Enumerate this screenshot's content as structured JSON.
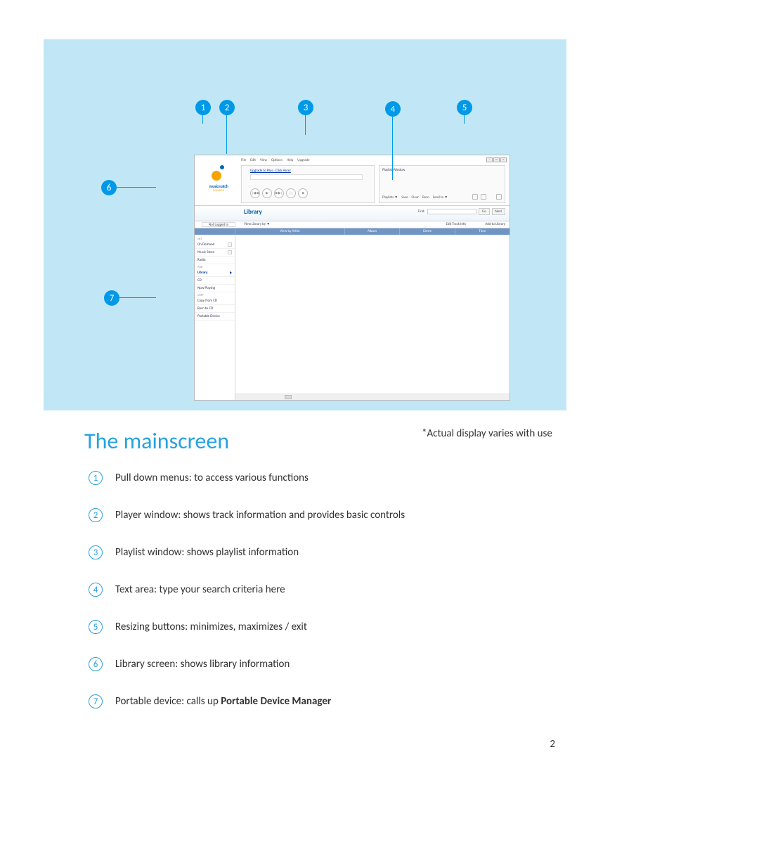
{
  "figure": {
    "caption": "*Actual display varies with use",
    "callouts": [
      "1",
      "2",
      "3",
      "4",
      "5",
      "6",
      "7"
    ]
  },
  "app": {
    "brand": {
      "name": "musicmatch",
      "sub": "JUKEBOX"
    },
    "menubar": [
      "File",
      "Edit",
      "View",
      "Options",
      "Help",
      "Upgrade"
    ],
    "upgrade_link": "Upgrade to Plus - Click Here!",
    "transport": {
      "prev": "|◀◀",
      "play": "▶",
      "next": "▶▶|",
      "pause": "||",
      "stop": "■"
    },
    "playlist": {
      "title": "Playlist Window",
      "tools": [
        "Playlists ▼",
        "Save",
        "Clear",
        "Burn",
        "Send to ▼"
      ]
    },
    "winbtns": [
      "–",
      "□",
      "×"
    ],
    "library": {
      "title": "Library",
      "find_label": "Find:",
      "go": "Go",
      "next": "Next",
      "login": "Not Logged In",
      "view_by": "View Library by ▼",
      "edit_track": "Edit Track Info",
      "add_to_lib": "Add to Library",
      "col1": "View by Artist",
      "col2": "Album",
      "col3": "Genre",
      "col4": "Time"
    },
    "sidebar": {
      "sec_net": "NET",
      "net": [
        "On Demand",
        "Music Store",
        "Radio"
      ],
      "sec_play": "PLAY",
      "play": [
        "Library",
        "CD",
        "Now Playing"
      ],
      "sec_copy": "COPY",
      "copy": [
        "Copy from CD",
        "Burn to CD",
        "Portable Device"
      ]
    }
  },
  "article": {
    "heading": "The mainscreen",
    "items": [
      {
        "n": "1",
        "text": "Pull down menus: to access various functions"
      },
      {
        "n": "2",
        "text": "Player window:  shows track information and provides basic controls"
      },
      {
        "n": "3",
        "text": "Playlist window:  shows playlist information"
      },
      {
        "n": "4",
        "text": "Text area: type your search criteria here"
      },
      {
        "n": "5",
        "text": "Resizing buttons: minimizes, maximizes / exit"
      },
      {
        "n": "6",
        "text": "Library screen:  shows library information"
      },
      {
        "n": "7",
        "text_pre": "Portable device: calls up ",
        "text_bold": "Portable Device Manager"
      }
    ],
    "page_number": "2"
  }
}
